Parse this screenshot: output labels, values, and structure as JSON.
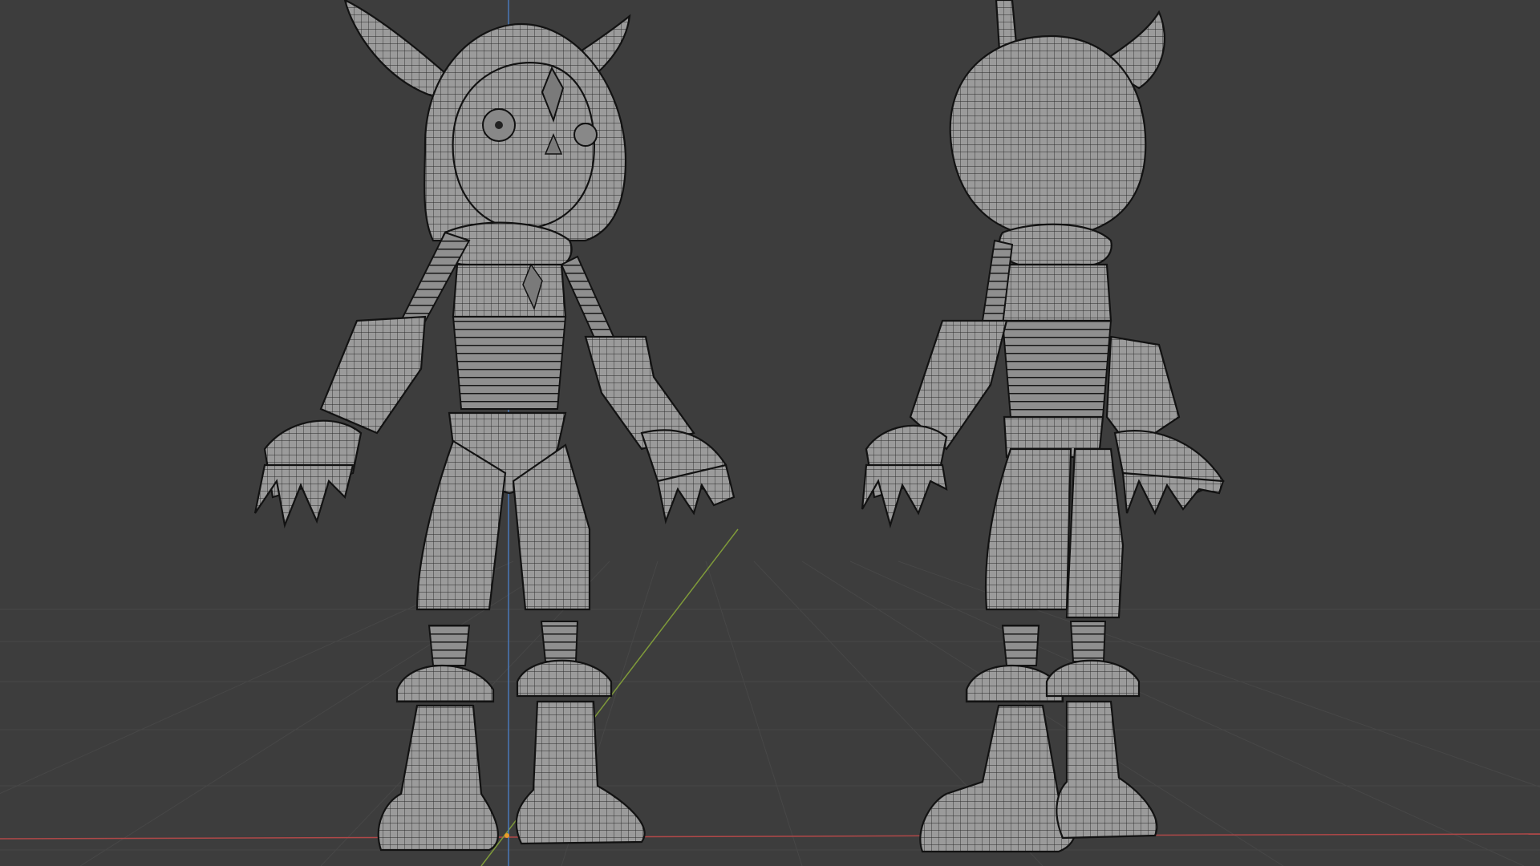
{
  "viewport": {
    "mode": "wireframe",
    "background_color": "#3d3d3d",
    "grid_color": "#4a4a4a",
    "mesh_color": "#9a9a9a",
    "wire_color": "#1a1a1a",
    "axis_x_color": "#b04848",
    "axis_y_color": "#7f9a3a",
    "axis_z_color": "#4a78b8",
    "objects": [
      {
        "view": "front",
        "description_name": "character-front-model"
      },
      {
        "view": "back",
        "description_name": "character-back-model"
      }
    ],
    "origin_marker_color": "#e89a2a"
  }
}
